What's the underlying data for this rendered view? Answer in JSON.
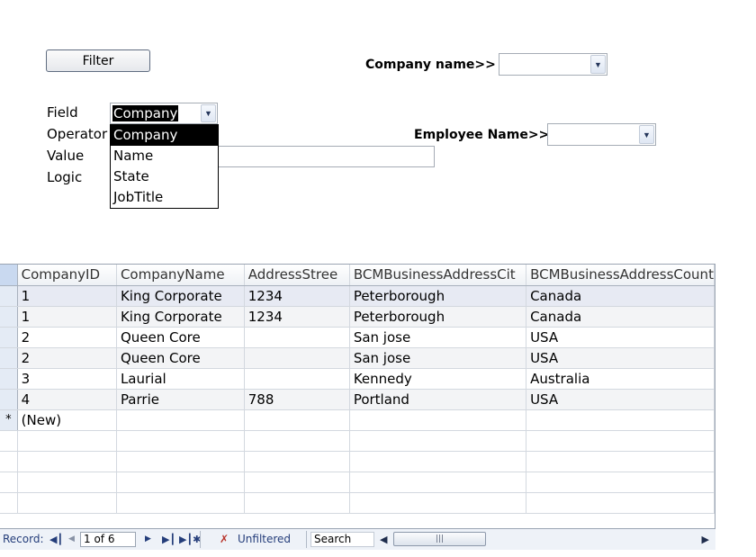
{
  "form": {
    "filter_button": "Filter",
    "company_name_label": "Company name>>",
    "employee_name_label": "Employee Name>>",
    "field_label": "Field",
    "operator_label": "Operator",
    "value_label": "Value",
    "logic_label": "Logic",
    "field_selected": "Company",
    "field_options": [
      "Company",
      "Name",
      "State",
      "JobTitle"
    ],
    "highlighted_option": "Company"
  },
  "grid": {
    "columns": [
      "CompanyID",
      "CompanyName",
      "AddressStree",
      "BCMBusinessAddressCit",
      "BCMBusinessAddressCount"
    ],
    "rows": [
      [
        "1",
        "King Corporate",
        "1234",
        "Peterborough",
        "Canada"
      ],
      [
        "1",
        "King Corporate",
        "1234",
        "Peterborough",
        "Canada"
      ],
      [
        "2",
        "Queen Core",
        "",
        "San jose",
        "USA"
      ],
      [
        "2",
        "Queen Core",
        "",
        "San jose",
        "USA"
      ],
      [
        "3",
        "Laurial",
        "",
        "Kennedy",
        "Australia"
      ],
      [
        "4",
        "Parrie",
        "788",
        "Portland",
        "USA"
      ]
    ],
    "new_row_marker": "*",
    "new_row_label": "(New)"
  },
  "nav": {
    "record_label": "Record:",
    "record_position": "1 of 6",
    "filter_status": "Unfiltered",
    "search_label": "Search",
    "first_icon": "first-record-icon",
    "prev_icon": "previous-record-icon",
    "next_icon": "next-record-icon",
    "last_icon": "last-record-icon",
    "new_icon": "new-record-icon",
    "filter_icon": "no-filter-icon"
  }
}
